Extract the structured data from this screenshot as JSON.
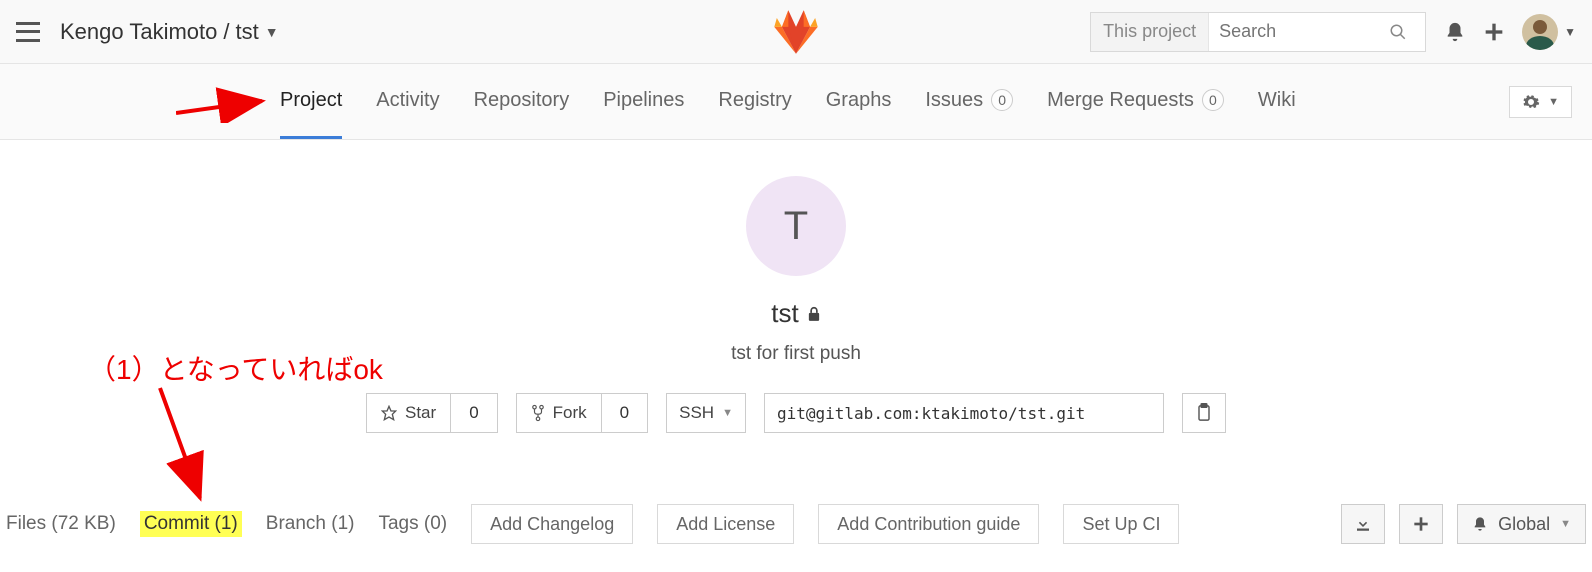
{
  "header": {
    "breadcrumb_owner": "Kengo Takimoto",
    "breadcrumb_sep": "/",
    "breadcrumb_project": "tst",
    "search_scope": "This project",
    "search_placeholder": "Search"
  },
  "nav": {
    "tabs": {
      "project": "Project",
      "activity": "Activity",
      "repository": "Repository",
      "pipelines": "Pipelines",
      "registry": "Registry",
      "graphs": "Graphs",
      "issues": "Issues",
      "issues_count": "0",
      "merge_requests": "Merge Requests",
      "merge_requests_count": "0",
      "wiki": "Wiki"
    }
  },
  "project": {
    "avatar_letter": "T",
    "name": "tst",
    "description": "tst for first push",
    "star_label": "Star",
    "star_count": "0",
    "fork_label": "Fork",
    "fork_count": "0",
    "clone_protocol": "SSH",
    "clone_url": "git@gitlab.com:ktakimoto/tst.git"
  },
  "infobar": {
    "files": "Files (72 KB)",
    "commit": "Commit (1)",
    "branch": "Branch (1)",
    "tags": "Tags (0)",
    "add_changelog": "Add Changelog",
    "add_license": "Add License",
    "add_contribution": "Add Contribution guide",
    "setup_ci": "Set Up CI",
    "notification_level": "Global"
  },
  "annotation": {
    "text": "（1）となっていればok"
  }
}
